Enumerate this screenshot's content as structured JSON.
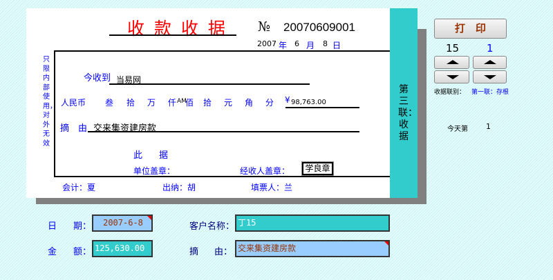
{
  "receipt": {
    "title": "收 款 收 据",
    "no_label": "№",
    "number": "20070609001",
    "date": {
      "year": "2007",
      "year_label": "年",
      "month": "6",
      "month_label": "月",
      "day": "8",
      "day_label": "日"
    },
    "side_note": "只限内部使用，对外无效",
    "received_from_label": "今收到",
    "received_from": "当易网",
    "rmb_label": "人民币",
    "digits": [
      "叁",
      "拾",
      "万",
      "仟",
      "AM",
      "佰",
      "拾",
      "元",
      "角",
      "分"
    ],
    "yen": "¥",
    "amount": "98,763.00",
    "reason_label_1": "摘",
    "reason_label_2": "由",
    "reason": "交来集资建房款",
    "ci": "此",
    "ju": "据",
    "unit_seal_label": "单位盖章：",
    "handler_seal_label": "经收人盖章：",
    "handler_seal": "学良章",
    "accountant": "会计：夏",
    "cashier": "出纳：胡",
    "filler": "填票人：兰",
    "copy_label": "第三联：收据"
  },
  "controls": {
    "print_label": "打　印",
    "counter_left": "15",
    "counter_right": "1",
    "copy_type_label": "收据联别：",
    "copy_type_value": "第一联：存根",
    "today_label": "今天第",
    "today_count": "1"
  },
  "form": {
    "date_label_1": "日",
    "date_label_2": "期：",
    "date_value": "2007-6-8",
    "customer_label": "客户名称：",
    "customer_value": "丁15",
    "amount_label_1": "金",
    "amount_label_2": "额：",
    "amount_value": "125,630.00",
    "reason_label_1": "摘",
    "reason_label_2": "由：",
    "reason_value": "交来集资建房款"
  },
  "colors": {
    "teal": "#33cccc",
    "light_blue": "#99ccff",
    "title_red": "#ff0000"
  }
}
